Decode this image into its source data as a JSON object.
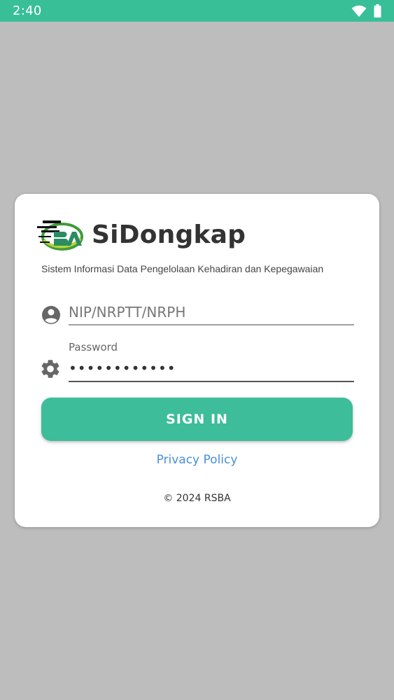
{
  "status_bar": {
    "time": "2:40",
    "background_color": "#39bf98",
    "icons": [
      "wifi-icon",
      "battery-icon"
    ]
  },
  "login_card": {
    "logo_text": "RSBA",
    "app_title": "SiDongkap",
    "app_subtitle": "Sistem Informasi Data Pengelolaan Kehadiran dan Kepegawaian",
    "nip_field": {
      "icon": "user-circle-icon",
      "placeholder": "NIP/NRPTT/NRPH",
      "value": ""
    },
    "password_field": {
      "icon": "gear-icon",
      "label": "Password",
      "value": "••••••••••••"
    },
    "sign_in_label": "SIGN IN",
    "privacy_link": "Privacy Policy",
    "copyright": "© 2024 RSBA"
  },
  "colors": {
    "accent": "#3dbd99",
    "link": "#4a8fd8",
    "background": "#bdbdbd"
  }
}
